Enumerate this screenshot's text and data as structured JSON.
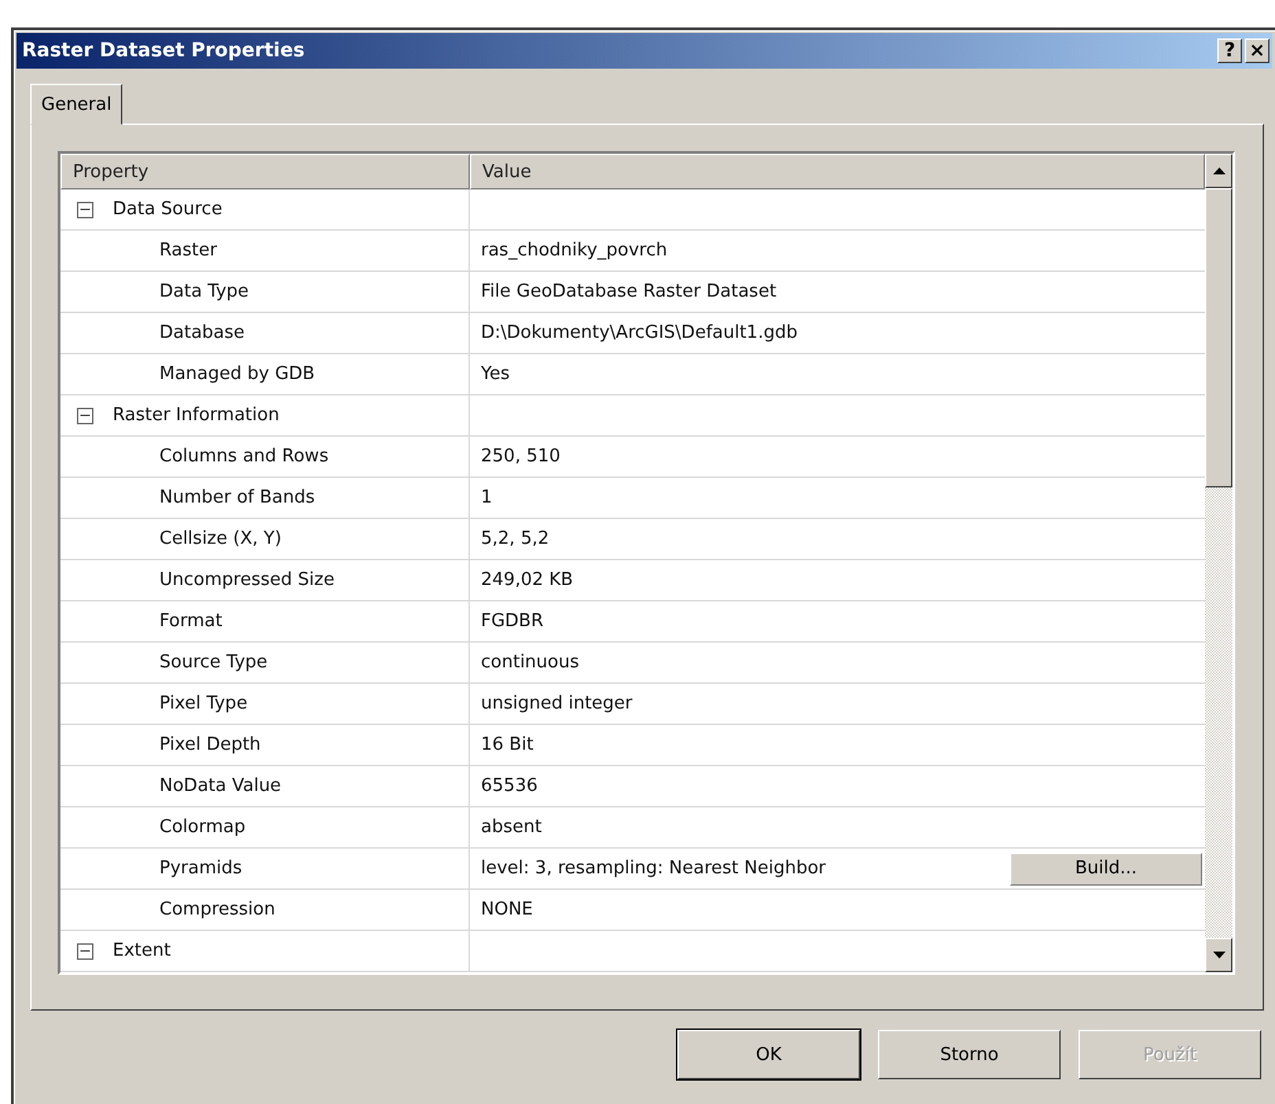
{
  "window": {
    "title": "Raster Dataset Properties",
    "title_buttons": [
      "?",
      "×"
    ]
  },
  "tabs": [
    {
      "label": "General",
      "selected": true
    }
  ],
  "table": {
    "columns": [
      "Property",
      "Value"
    ],
    "groups": [
      {
        "name": "Data Source",
        "expanded": true,
        "toggle": "−",
        "children": [
          {
            "property": "Raster",
            "value": "ras_chodniky_povrch"
          },
          {
            "property": "Data Type",
            "value": "File GeoDatabase Raster Dataset"
          },
          {
            "property": "Database",
            "value": "D:\\Dokumenty\\ArcGIS\\Default1.gdb"
          },
          {
            "property": "Managed by GDB",
            "value": "Yes"
          }
        ]
      },
      {
        "name": "Raster Information",
        "expanded": true,
        "toggle": "−",
        "children": [
          {
            "property": "Columns and Rows",
            "value": "250, 510"
          },
          {
            "property": "Number of Bands",
            "value": "1"
          },
          {
            "property": "Cellsize (X, Y)",
            "value": "5,2, 5,2"
          },
          {
            "property": "Uncompressed Size",
            "value": "249,02 KB"
          },
          {
            "property": "Format",
            "value": "FGDBR"
          },
          {
            "property": "Source Type",
            "value": "continuous"
          },
          {
            "property": "Pixel Type",
            "value": "unsigned integer"
          },
          {
            "property": "Pixel Depth",
            "value": "16 Bit"
          },
          {
            "property": "NoData Value",
            "value": "65536"
          },
          {
            "property": "Colormap",
            "value": "absent"
          },
          {
            "property": "Pyramids",
            "value": "level: 3, resampling: Nearest Neighbor",
            "button": "Build..."
          },
          {
            "property": "Compression",
            "value": "NONE"
          }
        ]
      },
      {
        "name": "Extent",
        "expanded": true,
        "toggle": "−"
      }
    ]
  },
  "buttons": [
    {
      "label": "OK",
      "disabled": false,
      "default": true
    },
    {
      "label": "Storno",
      "disabled": false,
      "default": false
    },
    {
      "label": "Použít",
      "disabled": true,
      "default": false
    }
  ]
}
